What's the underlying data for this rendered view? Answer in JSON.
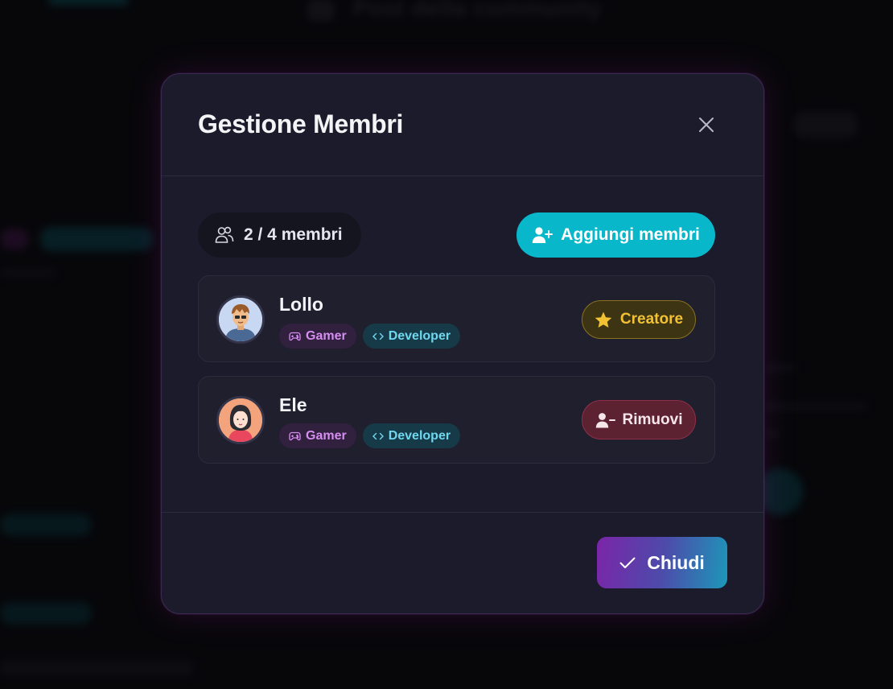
{
  "background": {
    "page_title": "Post della community"
  },
  "modal": {
    "title": "Gestione Membri",
    "member_count": "2 / 4 membri",
    "add_button_label": "Aggiungi membri",
    "members": [
      {
        "name": "Lollo",
        "tags": [
          {
            "label": "Gamer",
            "icon": "gamepad-icon"
          },
          {
            "label": "Developer",
            "icon": "code-icon"
          }
        ],
        "role": {
          "label": "Creatore",
          "icon": "star-icon",
          "color": "#f2c233"
        }
      },
      {
        "name": "Ele",
        "tags": [
          {
            "label": "Gamer",
            "icon": "gamepad-icon"
          },
          {
            "label": "Developer",
            "icon": "code-icon"
          }
        ],
        "action": {
          "label": "Rimuovi",
          "icon": "user-minus-icon",
          "color": "#5c2232"
        }
      }
    ],
    "close_button_label": "Chiudi"
  },
  "colors": {
    "accent_cyan": "#08b7c9",
    "accent_purple": "#7b25a8",
    "creator_gold": "#f2c233",
    "remove_red": "#8e2f47"
  }
}
